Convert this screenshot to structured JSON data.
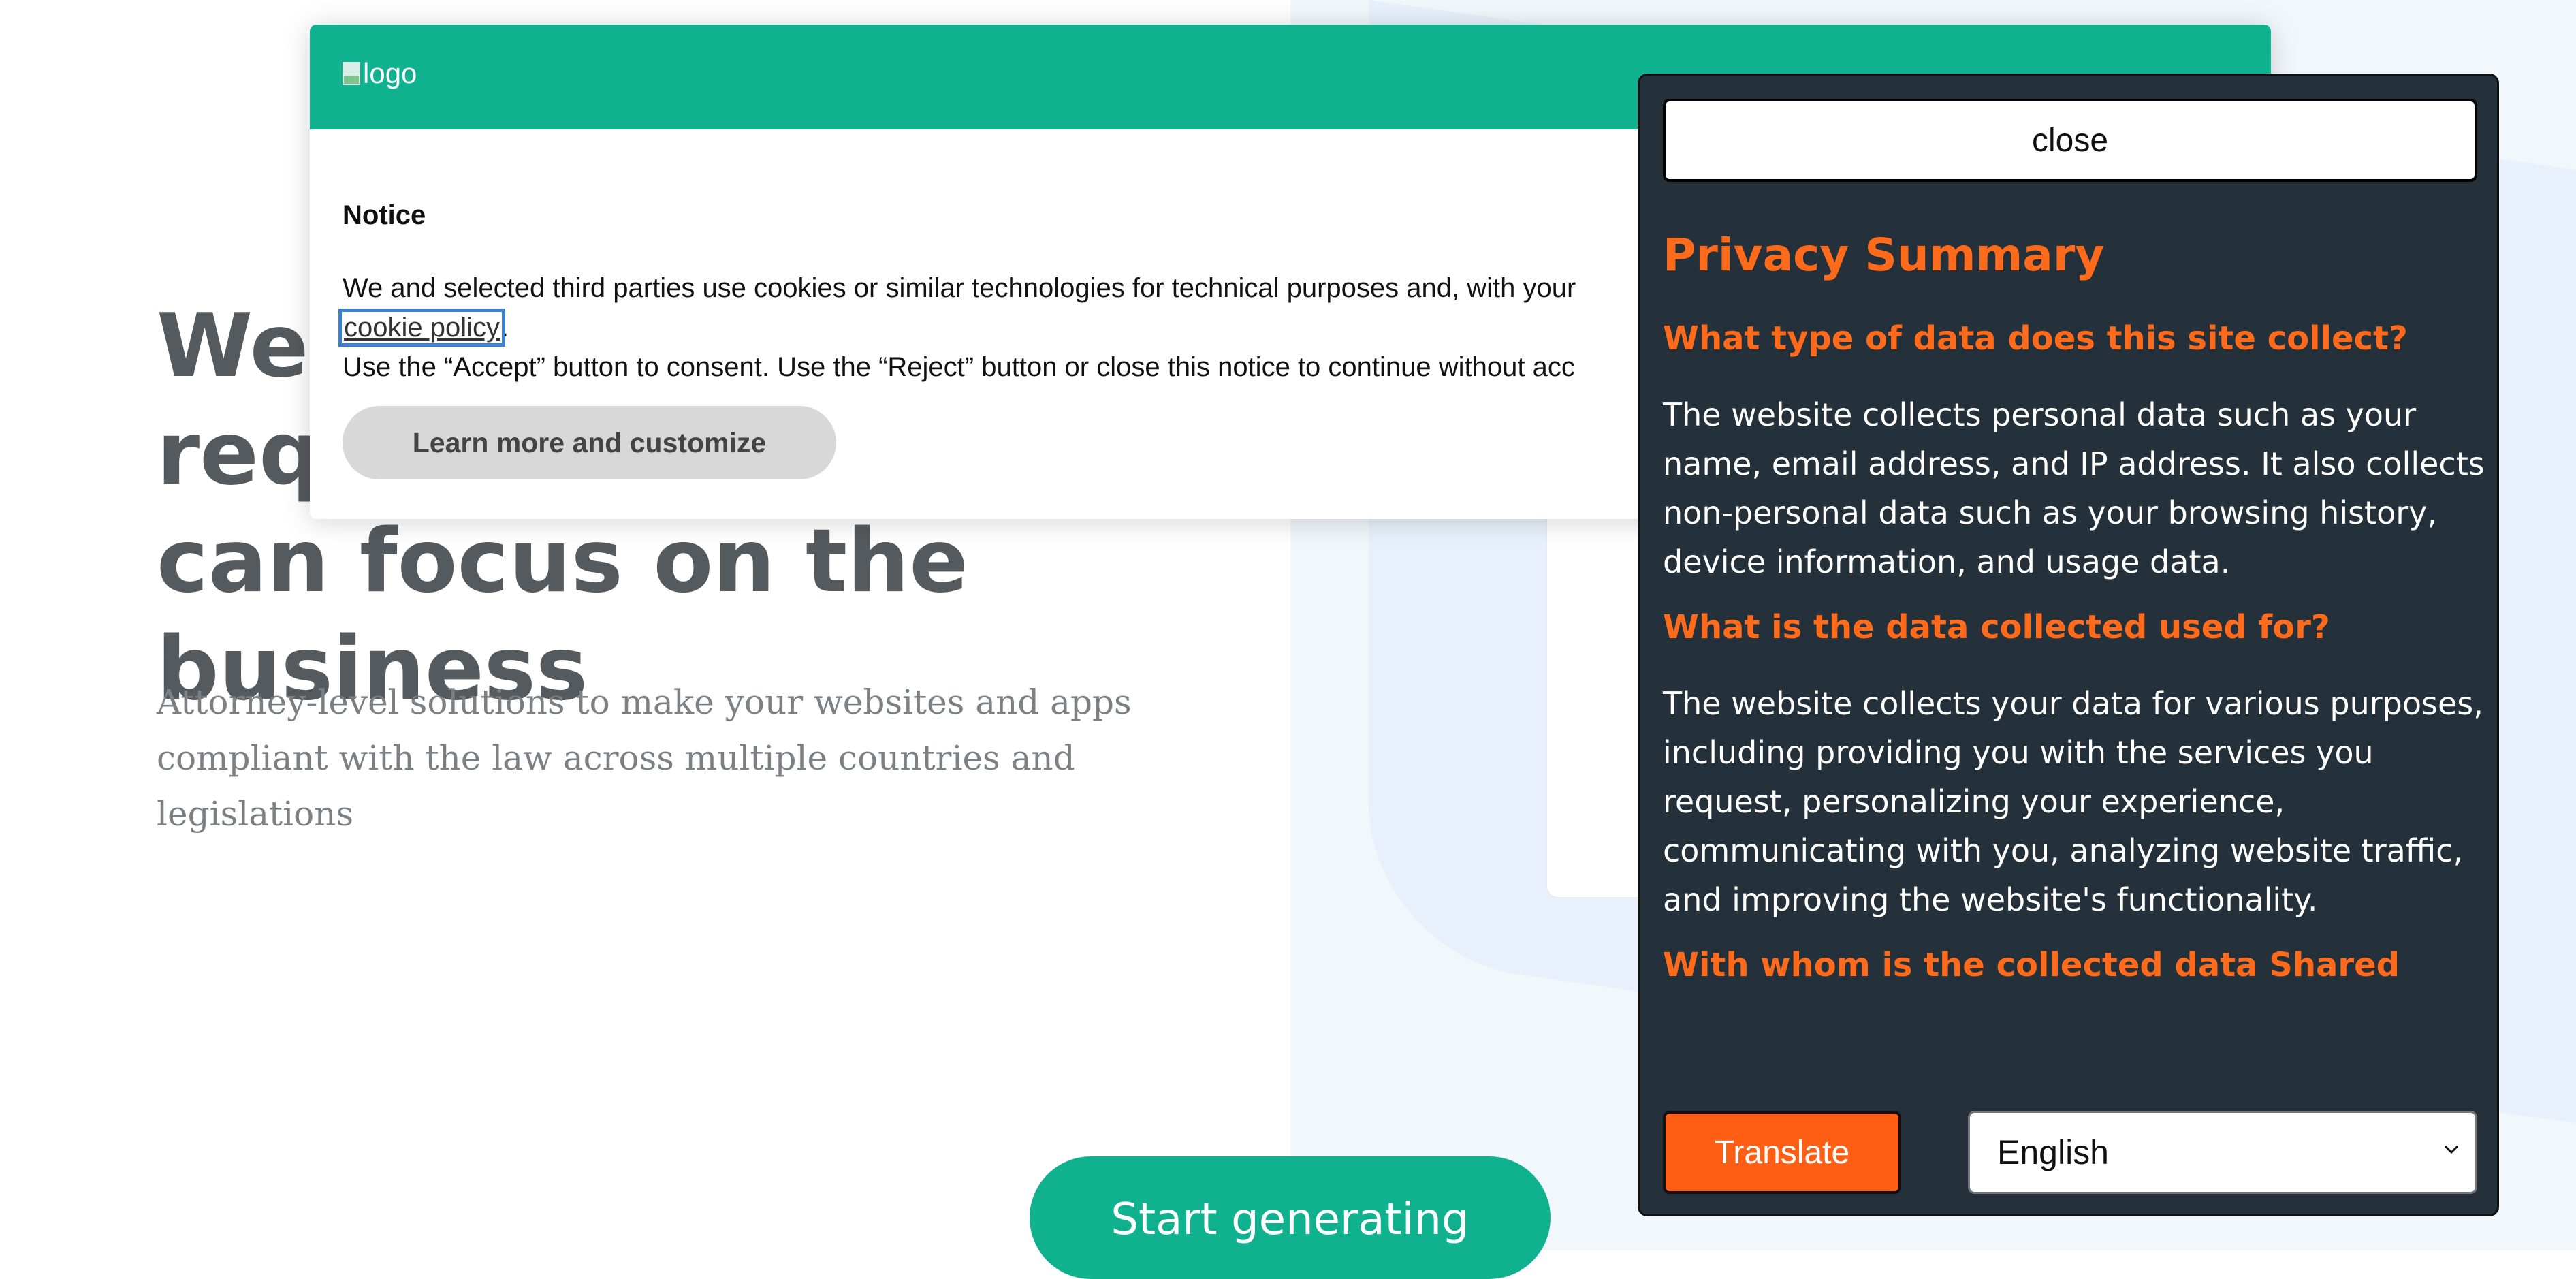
{
  "page": {
    "hero_title": "We handle the legal requirements so you can focus on the business",
    "hero_subtitle": "Attorney-level solutions to make your websites and apps compliant with the law across multiple countries and legislations",
    "cta_label": "Start generating"
  },
  "notice": {
    "logo_alt": "logo",
    "title": "Notice",
    "text_line1": "We and selected third parties use cookies or similar technologies for technical purposes and, with your",
    "cookie_link": "cookie policy",
    "text_after_link": ".",
    "text_line3": "Use the “Accept” button to consent. Use the “Reject” button or close this notice to continue without acc",
    "customize_label": "Learn more and customize"
  },
  "privacy_panel": {
    "close_label": "close",
    "title": "Privacy Summary",
    "sections": [
      {
        "question": "What type of data does this site collect?",
        "answer": "The website collects personal data such as your name, email address, and IP address. It also collects non-personal data such as your browsing history, device information, and usage data."
      },
      {
        "question": "What is the data collected used for?",
        "answer": "The website collects your data for various purposes, including providing you with the services you request, personalizing your experience, communicating with you, analyzing website traffic, and improving the website's functionality."
      },
      {
        "question": "With whom is the collected data Shared",
        "answer": ""
      }
    ],
    "translate_label": "Translate",
    "language_selected": "English"
  },
  "colors": {
    "brand_green": "#10b18f",
    "panel_bg": "#24303a",
    "accent_orange": "#ff6b1a"
  }
}
